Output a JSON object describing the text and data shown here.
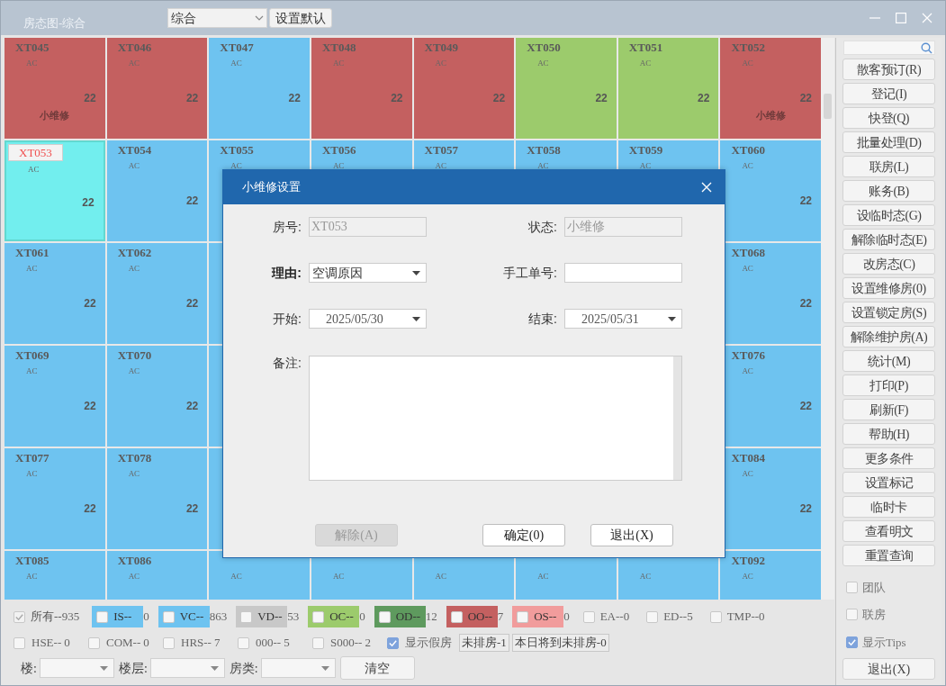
{
  "window": {
    "title": "房态图-综合",
    "view_select": "综合",
    "default_button": "设置默认"
  },
  "rooms": [
    {
      "name": "XT045",
      "ac": "AC",
      "rate": "22",
      "note": "小维修",
      "color": "#c46060",
      "selected": false
    },
    {
      "name": "XT046",
      "ac": "AC",
      "rate": "22",
      "color": "#c46060",
      "selected": false
    },
    {
      "name": "XT047",
      "ac": "AC",
      "rate": "22",
      "color": "#6ec3f0",
      "selected": false
    },
    {
      "name": "XT048",
      "ac": "AC",
      "rate": "22",
      "color": "#c46060",
      "selected": false
    },
    {
      "name": "XT049",
      "ac": "AC",
      "rate": "22",
      "color": "#c46060",
      "selected": false
    },
    {
      "name": "XT050",
      "ac": "AC",
      "rate": "22",
      "color": "#9ccb6c",
      "selected": false
    },
    {
      "name": "XT051",
      "ac": "AC",
      "rate": "22",
      "color": "#9ccb6c",
      "selected": false
    },
    {
      "name": "XT052",
      "ac": "AC",
      "rate": "22",
      "note": "小维修",
      "color": "#c46060",
      "selected": false
    },
    {
      "name": "XT053",
      "ac": "AC",
      "rate": "22",
      "selected": true
    },
    {
      "name": "XT054",
      "ac": "AC",
      "rate": "22",
      "color": "#6ec3f0",
      "selected": false
    },
    {
      "name": "XT055",
      "ac": "AC",
      "color": "#6ec3f0",
      "selected": false
    },
    {
      "name": "XT056",
      "ac": "AC",
      "color": "#6ec3f0",
      "selected": false
    },
    {
      "name": "XT057",
      "ac": "AC",
      "color": "#6ec3f0",
      "selected": false
    },
    {
      "name": "XT058",
      "ac": "AC",
      "color": "#6ec3f0",
      "selected": false
    },
    {
      "name": "XT059",
      "ac": "AC",
      "color": "#6ec3f0",
      "selected": false
    },
    {
      "name": "XT060",
      "ac": "AC",
      "rate": "22",
      "color": "#6ec3f0",
      "selected": false
    },
    {
      "name": "XT061",
      "ac": "AC",
      "rate": "22",
      "color": "#6ec3f0",
      "selected": false
    },
    {
      "name": "XT062",
      "ac": "AC",
      "rate": "22",
      "color": "#6ec3f0",
      "selected": false
    },
    {
      "name": "XT068",
      "ac": "AC",
      "rate": "22",
      "color": "#6ec3f0",
      "selected": false
    },
    {
      "name": "XT069",
      "ac": "AC",
      "rate": "22",
      "color": "#6ec3f0",
      "selected": false
    },
    {
      "name": "XT070",
      "ac": "AC",
      "rate": "22",
      "color": "#6ec3f0",
      "selected": false
    },
    {
      "name": "XT076",
      "ac": "AC",
      "rate": "22",
      "color": "#6ec3f0",
      "selected": false
    },
    {
      "name": "XT077",
      "ac": "AC",
      "rate": "22",
      "color": "#6ec3f0",
      "selected": false
    },
    {
      "name": "XT078",
      "ac": "AC",
      "rate": "22",
      "color": "#6ec3f0",
      "selected": false
    },
    {
      "name": "XT084",
      "ac": "AC",
      "rate": "22",
      "color": "#6ec3f0",
      "selected": false
    },
    {
      "name": "XT085",
      "ac": "AC",
      "color": "#6ec3f0",
      "selected": false
    },
    {
      "name": "XT086",
      "ac": "AC",
      "color": "#6ec3f0",
      "selected": false
    },
    {
      "ac": "AC",
      "color": "#6ec3f0",
      "selected": false
    },
    {
      "ac": "AC",
      "color": "#6ec3f0",
      "selected": false
    },
    {
      "ac": "AC",
      "color": "#6ec3f0",
      "selected": false
    },
    {
      "ac": "AC",
      "color": "#6ec3f0",
      "selected": false
    },
    {
      "ac": "AC",
      "color": "#6ec3f0",
      "selected": false
    },
    {
      "name": "XT092",
      "ac": "AC",
      "color": "#6ec3f0",
      "selected": false
    }
  ],
  "legend_row_1": [
    {
      "code": "所有--",
      "count": "935",
      "checked": true,
      "disabled": true
    },
    {
      "code": "IS--",
      "count": "0",
      "checked": false,
      "color": "#6ec3f0"
    },
    {
      "code": "VC--",
      "count": "863",
      "checked": false,
      "color": "#6ec3f0"
    },
    {
      "code": "VD--",
      "count": "53",
      "checked": false,
      "color": "#c8c8c8"
    },
    {
      "code": "OC--",
      "count": "0",
      "checked": false,
      "color": "#9ccb6c"
    },
    {
      "code": "OD--",
      "count": "12",
      "checked": false,
      "color": "#5e9a5e"
    },
    {
      "code": "OO--",
      "count": "7",
      "checked": false,
      "color": "#c46060"
    },
    {
      "code": "OS--",
      "count": "0",
      "checked": false,
      "color": "#f19c9c"
    },
    {
      "code": "EA--",
      "count": "0",
      "checked": false
    },
    {
      "code": "ED--",
      "count": "5",
      "checked": false
    },
    {
      "code": "TMP--",
      "count": "0",
      "checked": false
    }
  ],
  "legend_row_2": [
    {
      "code": "HSE--",
      "count": "0",
      "checked": false
    },
    {
      "code": "COM--",
      "count": "0",
      "checked": false
    },
    {
      "code": "HRS--",
      "count": "7",
      "checked": false
    },
    {
      "code": "000--",
      "count": "5",
      "checked": false
    },
    {
      "code": "S000--",
      "count": "2",
      "checked": false
    },
    {
      "code": "显示假房",
      "checked": true
    }
  ],
  "counters": [
    "未排房-1",
    "本日将到未排房-0"
  ],
  "filters": [
    {
      "label": "楼:"
    },
    {
      "label": "楼层:"
    },
    {
      "label": "房类:"
    }
  ],
  "clear_button": "清空",
  "side_buttons": [
    "散客预订(R)",
    "登记(I)",
    "快登(Q)",
    "批量处理(D)",
    "联房(L)",
    "账务(B)",
    "设临时态(G)",
    "解除临时态(E)",
    "改房态(C)",
    "设置维修房(0)",
    "设置锁定房(S)",
    "解除维护房(A)",
    "统计(M)",
    "打印(P)",
    "刷新(F)",
    "帮助(H)",
    "更多条件",
    "设置标记",
    "临时卡",
    "查看明文",
    "重置查询"
  ],
  "side_options": [
    {
      "label": "团队",
      "checked": false
    },
    {
      "label": "联房",
      "checked": false
    },
    {
      "label": "显示Tips",
      "checked": true
    }
  ],
  "side_exit": "退出(X)",
  "dialog": {
    "title": "小维修设置",
    "fields": [
      {
        "kind": "readonly",
        "label": "房号:",
        "value": "XT053"
      },
      {
        "kind": "readonly",
        "label": "状态:",
        "value": "小维修"
      },
      {
        "kind": "select",
        "label": "理由:",
        "value": "空调原因",
        "bold": true
      },
      {
        "kind": "text",
        "label": "手工单号:"
      },
      {
        "kind": "date",
        "label": "开始:",
        "value": "2025/05/30"
      },
      {
        "kind": "date",
        "label": "结束:",
        "value": "2025/05/31"
      }
    ],
    "note_label": "备注:",
    "buttons": [
      {
        "label": "解除(A)",
        "disabled": true
      },
      {
        "label": "确定(0)",
        "disabled": false
      },
      {
        "label": "退出(X)",
        "disabled": false
      }
    ]
  }
}
